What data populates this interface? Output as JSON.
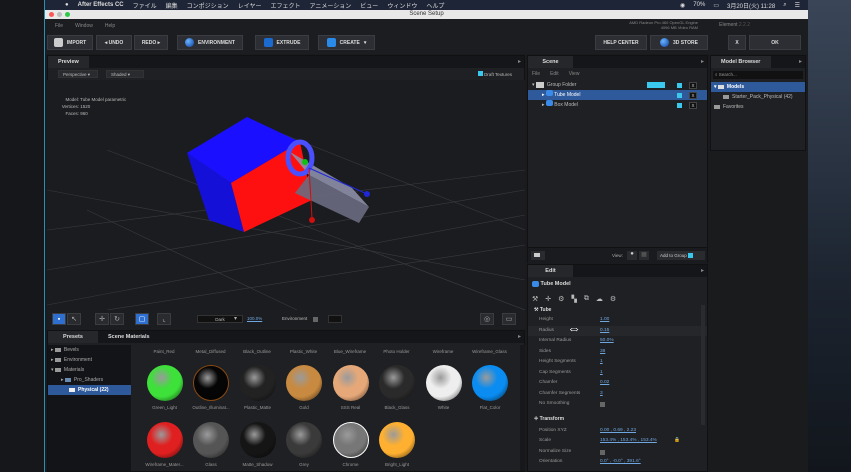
{
  "macos": {
    "app_name": "After Effects CC",
    "menus": [
      "ファイル",
      "編集",
      "コンポジション",
      "レイヤー",
      "エフェクト",
      "アニメーション",
      "ビュー",
      "ウィンドウ",
      "ヘルプ"
    ],
    "battery": "70%",
    "datetime": "3月20日(火) 11:28"
  },
  "window": {
    "title": "Scene Setup",
    "menu": [
      "File",
      "Window",
      "Help"
    ],
    "gpu_line1": "AMD Radeon Pro 460 OpenGL Engine",
    "gpu_line2": "4096 MB Video RAM",
    "version_label": "Element",
    "version": "2.2.2"
  },
  "toolbar": {
    "import": "IMPORT",
    "undo": "◂ UNDO",
    "redo": "REDO ▸",
    "environment": "ENVIRONMENT",
    "extrude": "EXTRUDE",
    "create": "CREATE",
    "help_center": "HELP CENTER",
    "store": "3D STORE",
    "close": "X",
    "ok": "OK"
  },
  "preview": {
    "tab": "Preview",
    "camera": "Perspective",
    "mode": "Shaded",
    "draft_textures": "Draft Textures",
    "info": {
      "model_label": "Model:",
      "model": "Tube Model parametric",
      "vertices_label": "Vertices:",
      "vertices": "1520",
      "faces_label": "Faces:",
      "faces": "960"
    },
    "env_preset": "Dark",
    "zoom": "100.0%",
    "environment": "Environment"
  },
  "presets": {
    "tabs": [
      "Presets",
      "Scene Materials"
    ],
    "tree": [
      {
        "label": "Bevels"
      },
      {
        "label": "Environment"
      },
      {
        "label": "Materials"
      },
      {
        "label": "Pro_Shaders"
      },
      {
        "label": "Physical (22)"
      }
    ],
    "materials_top": [
      "Paint_Red",
      "Metal_Diffused",
      "Black_Outline",
      "Plastic_White",
      "Blue_Wireframe",
      "Photo Holder",
      "Wireframe",
      "Wireframe_Glass"
    ],
    "materials": [
      {
        "name": "Green_Light",
        "color": "#3ee03a"
      },
      {
        "name": "Outline_Illuminat...",
        "color": "#050505"
      },
      {
        "name": "Plastic_Matte",
        "color": "#222"
      },
      {
        "name": "Gold",
        "color": "#c88a40"
      },
      {
        "name": "SSS Real",
        "color": "#e6a878"
      },
      {
        "name": "Black_Glass",
        "color": "#2a2a2a"
      },
      {
        "name": "White",
        "color": "#eeeeee"
      },
      {
        "name": "Flat_Color",
        "color": "#0a8cf0"
      },
      {
        "name": "Wireframe_Mater...",
        "color": "#e02020"
      },
      {
        "name": "Glass",
        "color": "#555"
      },
      {
        "name": "Matte_Shadow",
        "color": "#151515"
      },
      {
        "name": "Grey",
        "color": "#3a3a3a"
      },
      {
        "name": "Chrome",
        "color": "#777"
      },
      {
        "name": "Bright_Light",
        "color": "#ffb030"
      }
    ]
  },
  "scene": {
    "tab": "Scene",
    "menu": [
      "File",
      "Edit",
      "View"
    ],
    "items": [
      {
        "label": "Group Folder"
      },
      {
        "label": "Tube Model"
      },
      {
        "label": "Box Model"
      }
    ],
    "view_label": "View:",
    "add_to_group": "Add to Group"
  },
  "model_browser": {
    "tab": "Model Browser",
    "search_placeholder": "Search...",
    "items": [
      {
        "label": "Models"
      },
      {
        "label": "Starter_Pack_Physical (42)"
      },
      {
        "label": "Favorites"
      }
    ]
  },
  "edit": {
    "tab": "Edit",
    "model": "Tube Model",
    "section_tube": "Tube",
    "tube_props": [
      {
        "label": "Height",
        "value": "1.00"
      },
      {
        "label": "Radius",
        "value": "0.15"
      },
      {
        "label": "Internal Radius",
        "value": "50.0%"
      },
      {
        "label": "Sides",
        "value": "38"
      },
      {
        "label": "Height Segments",
        "value": "1"
      },
      {
        "label": "Cap Segments",
        "value": "1"
      },
      {
        "label": "Chamfer",
        "value": "0.02"
      },
      {
        "label": "Chamfer Segments",
        "value": "3"
      }
    ],
    "no_smoothing": "No Smoothing",
    "section_transform": "Transform",
    "position_label": "Position XYZ",
    "position": "0.00 ,  0.69 ,  2.23",
    "scale_label": "Scale",
    "scale": "153.4% ,  153.4% ,  153.4%",
    "normalize_label": "Normalize Size",
    "orientation_label": "Orientation",
    "orientation": "0.0° ,  -0.0° ,  391.6°"
  },
  "colors": {
    "accent": "#2e5a9c",
    "cube_front": "#ff1010",
    "cube_side": "#1a10ff"
  }
}
